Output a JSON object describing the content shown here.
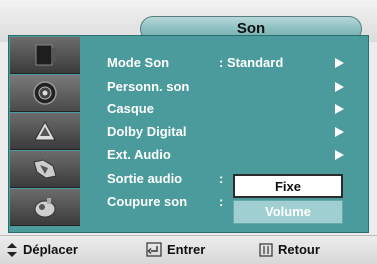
{
  "header": {
    "title": "Son"
  },
  "sidebar": {
    "items": [
      {
        "icon": "picture-icon"
      },
      {
        "icon": "speaker-icon"
      },
      {
        "icon": "channel-icon"
      },
      {
        "icon": "setup-icon"
      },
      {
        "icon": "input-icon"
      }
    ]
  },
  "menu": {
    "items": [
      {
        "label": "Mode Son",
        "value": ": Standard",
        "arrow": true
      },
      {
        "label": "Personn. son",
        "value": "",
        "arrow": true
      },
      {
        "label": "Casque",
        "value": "",
        "arrow": true
      },
      {
        "label": "Dolby Digital",
        "value": "",
        "arrow": true
      },
      {
        "label": "Ext. Audio",
        "value": "",
        "arrow": true
      },
      {
        "label": "Sortie audio",
        "value": ":",
        "arrow": false
      },
      {
        "label": "Coupure son",
        "value": ":",
        "arrow": false
      }
    ]
  },
  "dropdown": {
    "options": [
      "Fixe",
      "Volume"
    ],
    "selected": "Fixe"
  },
  "footer": {
    "move_label": "Déplacer",
    "enter_label": "Entrer",
    "back_label": "Retour"
  }
}
